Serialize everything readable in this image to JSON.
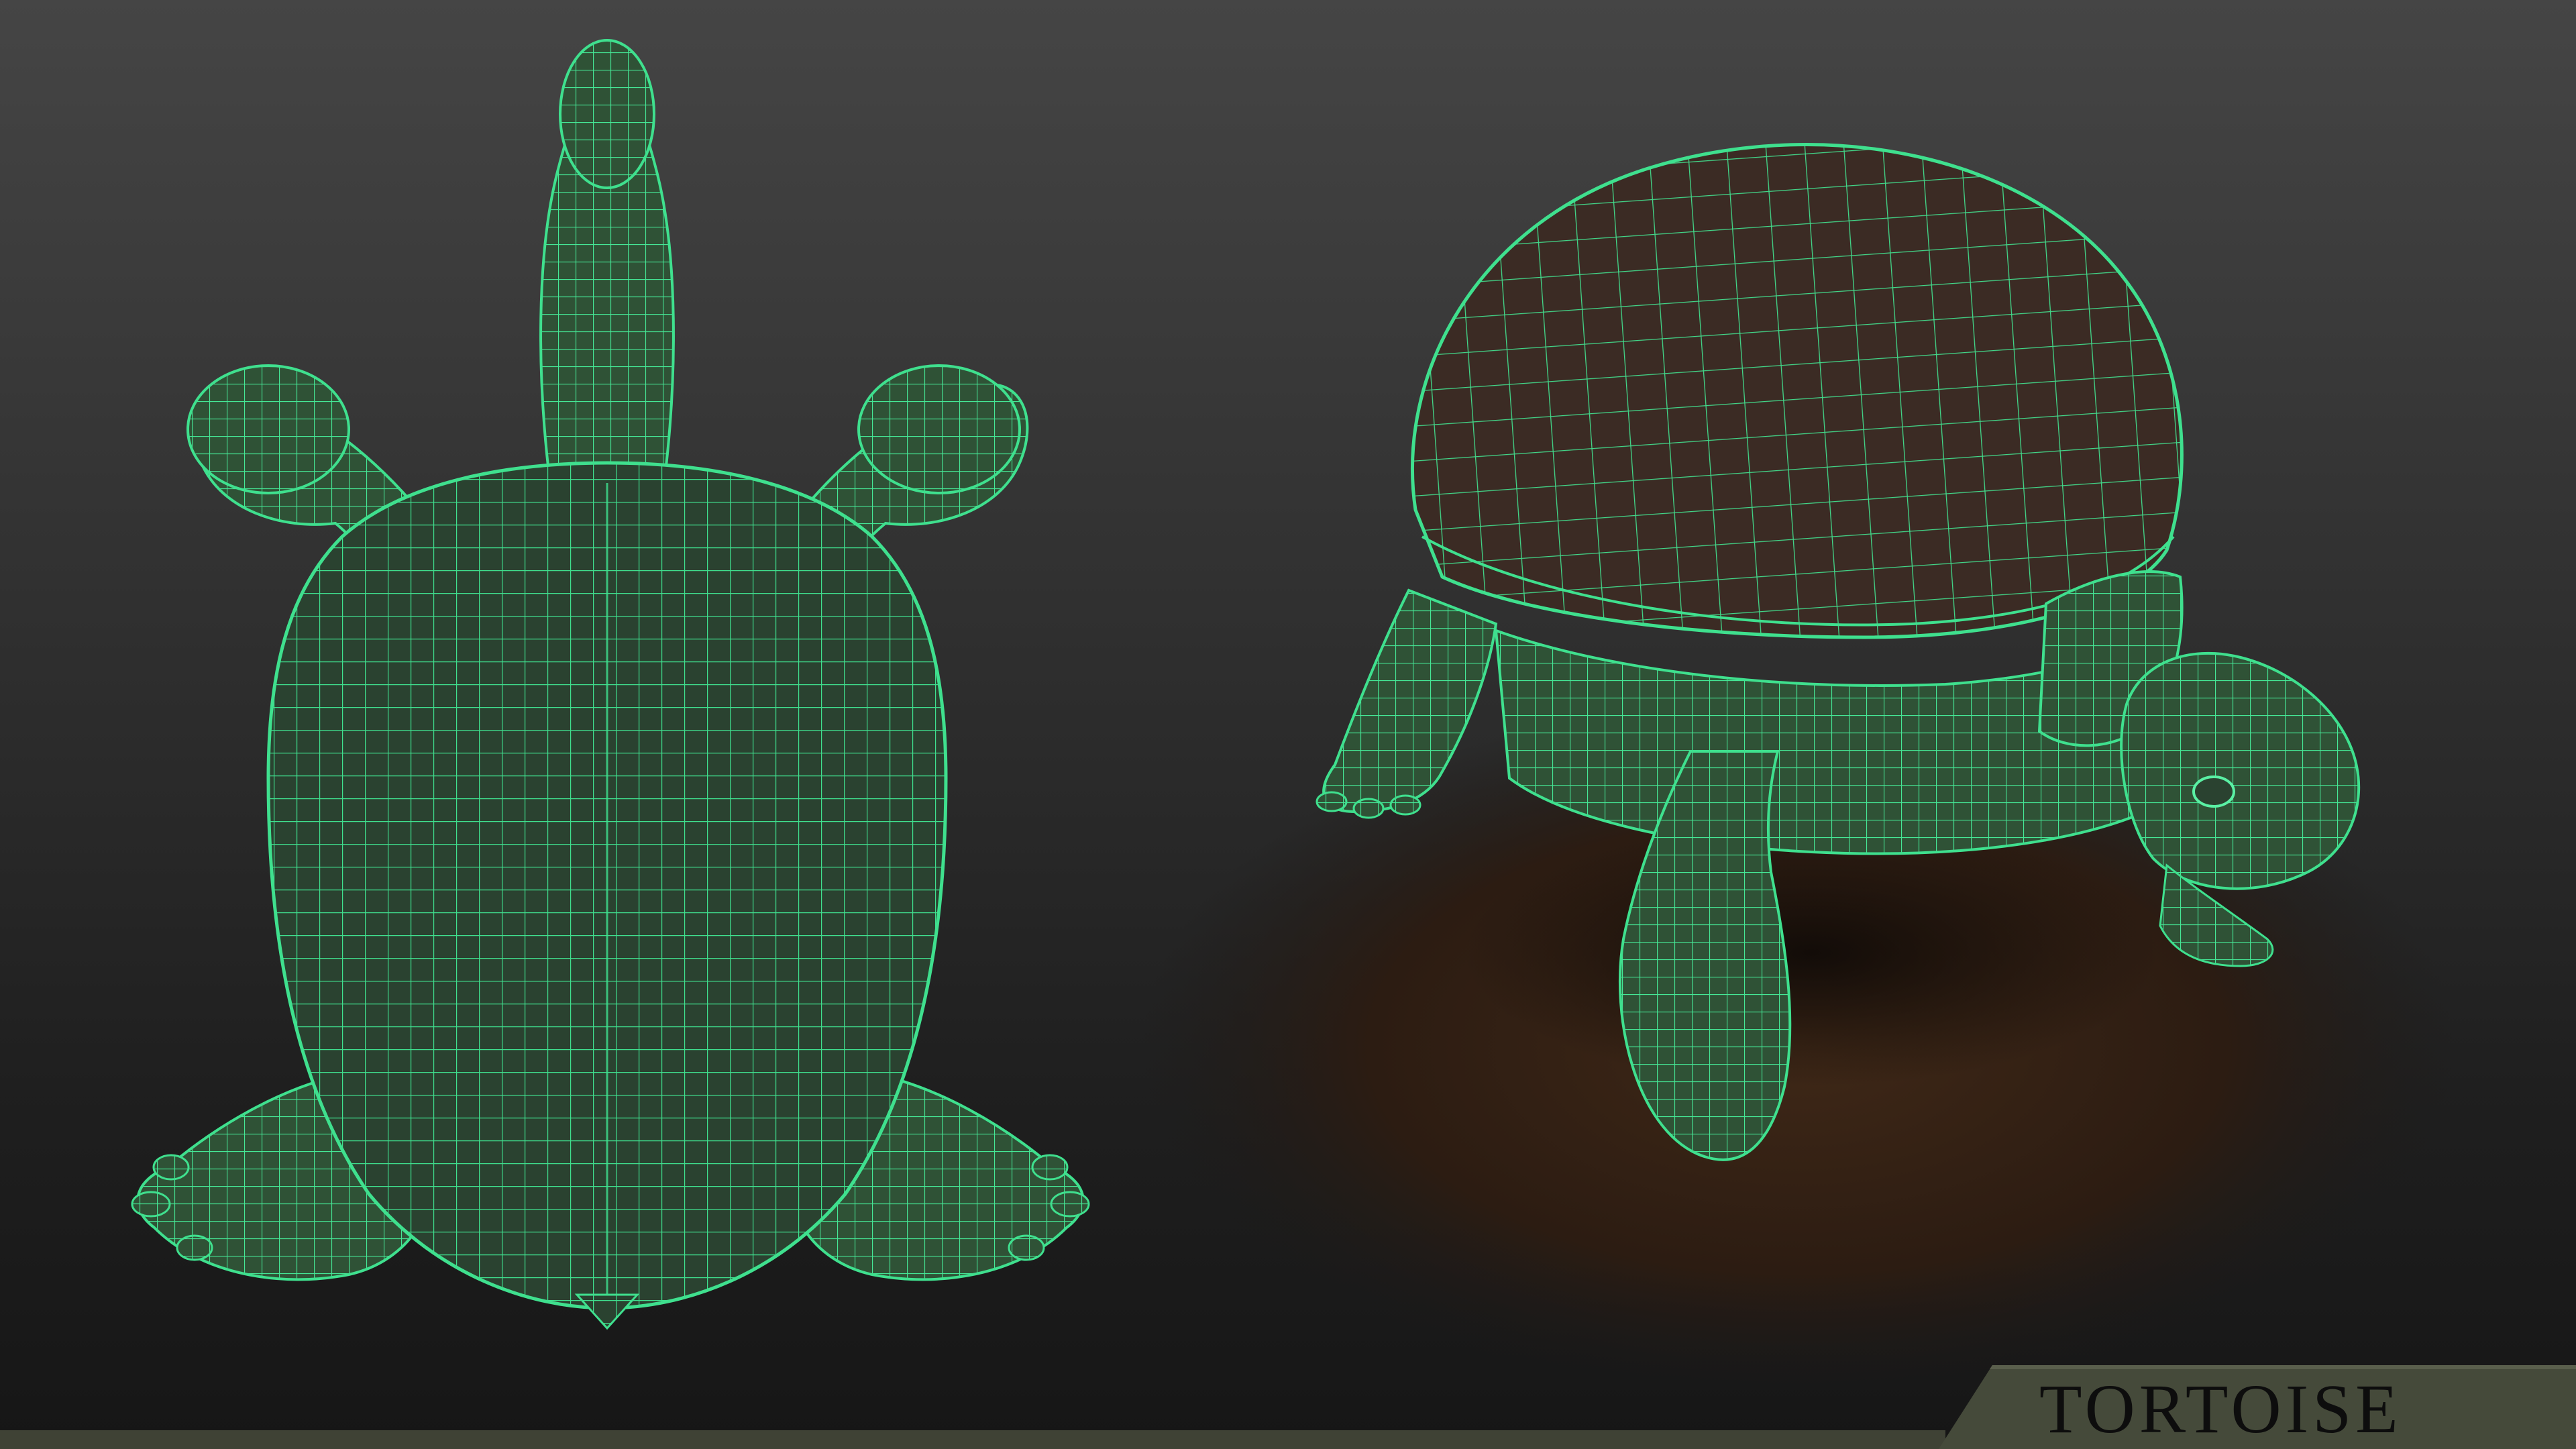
{
  "title": "TORTOISE",
  "colors": {
    "background_top": "#454545",
    "background_bottom": "#161616",
    "wireframe": "#3fe08e",
    "model_fill": "#2c4a33",
    "shell_fill": "#3a2a22",
    "ground": "#3a2416",
    "title_plate": "#454a3a",
    "title_text": "#0d0d0d"
  },
  "views": [
    {
      "name": "bottom-view",
      "description_visible": false
    },
    {
      "name": "perspective-view",
      "description_visible": false
    }
  ]
}
